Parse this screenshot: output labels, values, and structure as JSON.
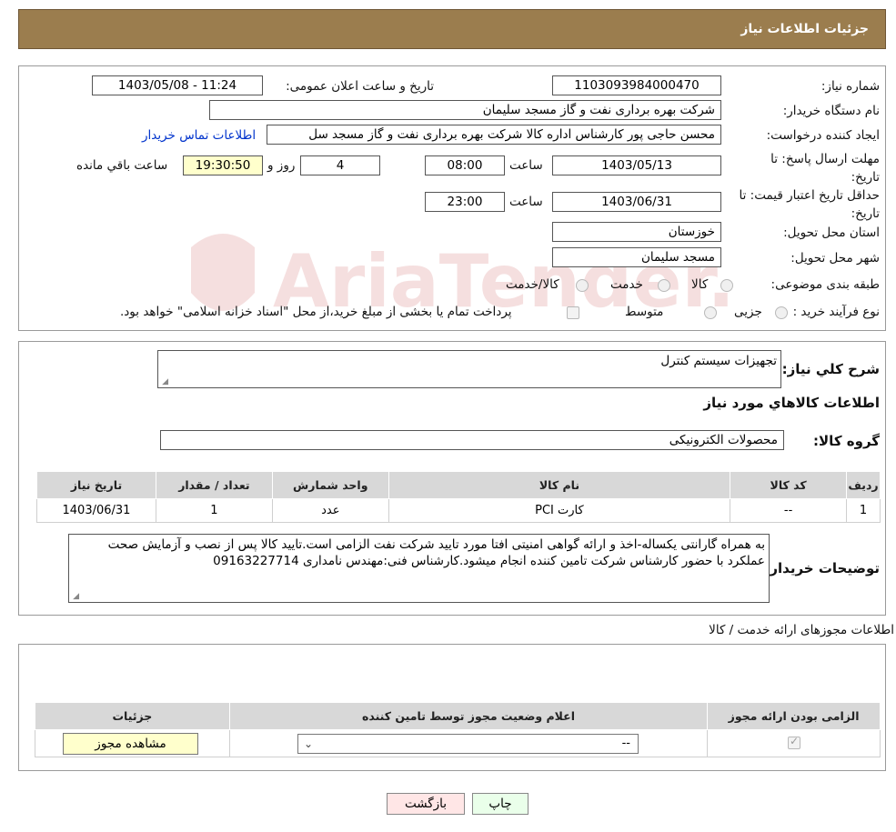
{
  "header": {
    "title": "جزئیات اطلاعات نیاز"
  },
  "form": {
    "need_number_label": "شماره نیاز:",
    "need_number": "1103093984000470",
    "announce_label": "تاریخ و ساعت اعلان عمومی:",
    "announce_value": "1403/05/08 - 11:24",
    "buyer_org_label": "نام دستگاه خریدار:",
    "buyer_org": "شرکت بهره برداری نفت و گاز مسجد سلیمان",
    "creator_label": "ایجاد کننده درخواست:",
    "creator": "محسن حاجی پور کارشناس اداره کالا  شرکت بهره برداری نفت و گاز مسجد سل",
    "contact_link": "اطلاعات تماس خریدار",
    "deadline_label": "مهلت ارسال پاسخ: تا تاریخ:",
    "deadline_date": "1403/05/13",
    "time_label": "ساعت",
    "deadline_time": "08:00",
    "days_value": "4",
    "days_label": "روز و",
    "remaining_time": "19:30:50",
    "remaining_label": "ساعت باقي مانده",
    "validity_label": "حداقل تاریخ اعتبار قیمت: تا تاریخ:",
    "validity_date": "1403/06/31",
    "validity_time": "23:00",
    "province_label": "استان محل تحویل:",
    "province": "خوزستان",
    "city_label": "شهر محل تحویل:",
    "city": "مسجد سلیمان",
    "category_label": "طبقه بندی موضوعی:",
    "category_options": [
      "کالا",
      "خدمت",
      "کالا/خدمت"
    ],
    "process_label": "نوع فرآیند خرید :",
    "process_options": [
      "جزیی",
      "متوسط"
    ],
    "payment_note": "پرداخت تمام یا بخشی از مبلغ خرید،از محل \"اسناد خزانه اسلامی\" خواهد بود."
  },
  "summary": {
    "desc_label": "شرح کلي نياز:",
    "desc_value": "تجهیزات سیستم کنترل",
    "goods_title": "اطلاعات کالاهاي مورد نياز",
    "group_label": "گروه کالا:",
    "group_value": "محصولات الکترونیکی",
    "columns": [
      "رديف",
      "کد کالا",
      "نام کالا",
      "واحد شمارش",
      "تعداد / مقدار",
      "تاریخ نیاز"
    ],
    "rows": [
      [
        "1",
        "--",
        "کارت PCI",
        "عدد",
        "1",
        "1403/06/31"
      ]
    ],
    "notes_label": "توضیحات خریدار:",
    "notes_value": "به همراه گارانتی یکساله-اخذ و ارائه گواهی امنیتی افتا مورد تایید شرکت نفت الزامی است.تایید کالا پس از نصب و آزمایش صحت عملکرد با حضور کارشناس شرکت تامین کننده انجام میشود.کارشناس فنی:مهندس نامداری 09163227714"
  },
  "licenses": {
    "section_title": "اطلاعات مجوزهای ارائه خدمت / کالا",
    "columns": [
      "الزامی بودن ارائه مجوز",
      "اعلام وضعیت مجوز توسط تامین کننده",
      "جزئیات"
    ],
    "select_value": "--",
    "view_button": "مشاهده مجوز"
  },
  "buttons": {
    "print": "چاپ",
    "back": "بازگشت"
  },
  "watermark_text": "AriaTender.neT"
}
